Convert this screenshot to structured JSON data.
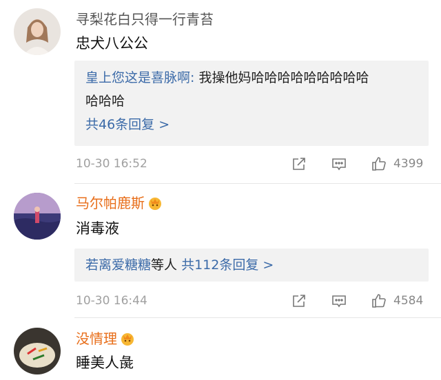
{
  "comments": [
    {
      "username": "寻梨花白只得一行青苔",
      "text": "忠犬八公公",
      "reply_user": "皇上您这是喜脉啊:",
      "reply_text_1": "我操他妈哈哈哈哈哈哈哈哈哈",
      "reply_text_2": "哈哈哈",
      "reply_more": "共46条回复 >",
      "time": "10-30 16:52",
      "likes": "4399"
    },
    {
      "username": "马尔帕鹿斯",
      "text": "消毒液",
      "reply_summary_users": "若离爱糖糖",
      "reply_summary_mid": "等人",
      "reply_more": "共112条回复 >",
      "time": "10-30 16:44",
      "likes": "4584"
    },
    {
      "username": "没情理",
      "text": "睡美人彘"
    }
  ],
  "colors": {
    "link_blue": "#3b6aa8",
    "username_orange": "#e86e1a"
  }
}
